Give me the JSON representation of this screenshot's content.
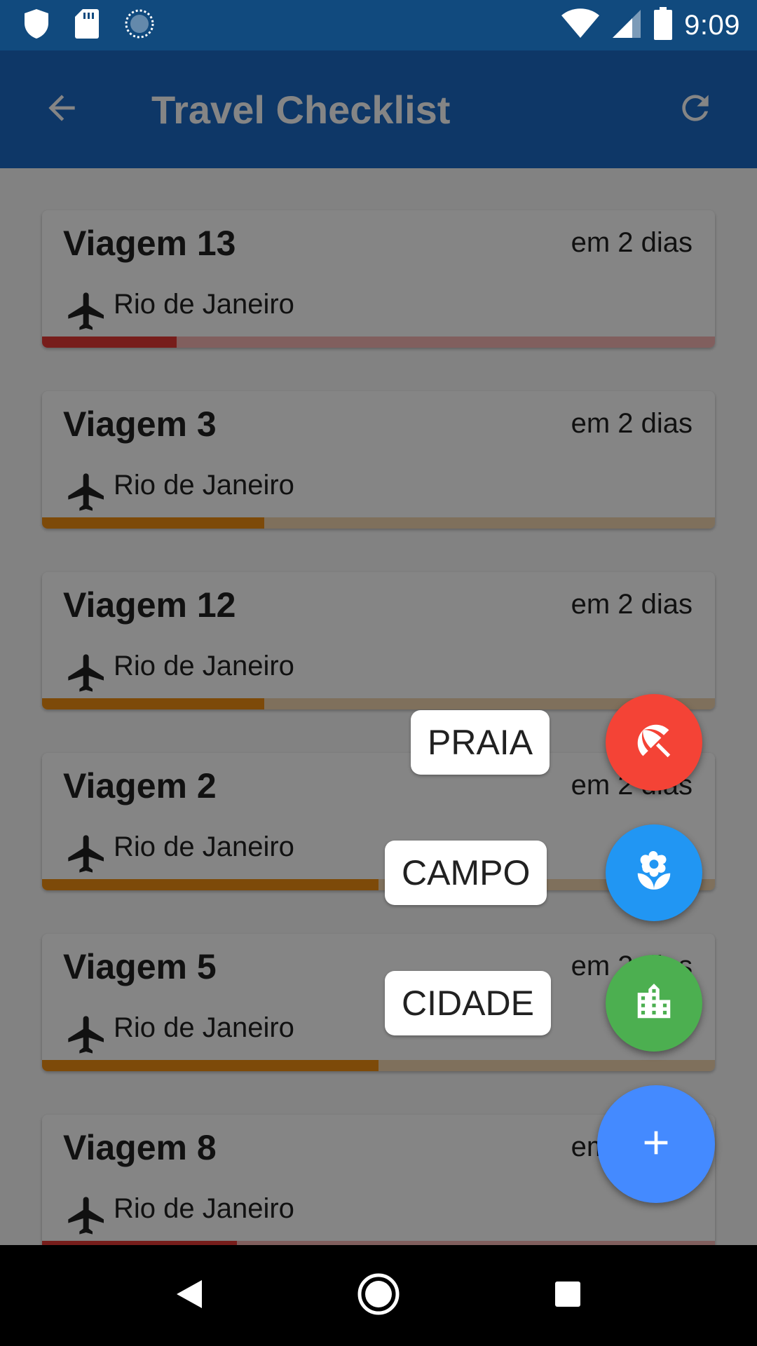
{
  "status_bar": {
    "time": "9:09",
    "left_icons": [
      "shield-icon",
      "sd-card-icon",
      "sync-icon"
    ],
    "right_icons": [
      "wifi-icon",
      "cell-signal-icon",
      "battery-icon"
    ]
  },
  "app_bar": {
    "title": "Travel Checklist",
    "back_icon": "arrow-back-icon",
    "refresh_icon": "refresh-icon"
  },
  "trips": [
    {
      "name": "Viagem 13",
      "when": "em 2 dias",
      "destination": "Rio de Janeiro",
      "progress": 0.2,
      "color": "#e53935",
      "track": "#f7b6b5"
    },
    {
      "name": "Viagem 3",
      "when": "em 2 dias",
      "destination": "Rio de Janeiro",
      "progress": 0.33,
      "color": "#ef8f12",
      "track": "#f3d6b0"
    },
    {
      "name": "Viagem 12",
      "when": "em 2 dias",
      "destination": "Rio de Janeiro",
      "progress": 0.33,
      "color": "#ef8f12",
      "track": "#f3d6b0"
    },
    {
      "name": "Viagem 2",
      "when": "em 2 dias",
      "destination": "Rio de Janeiro",
      "progress": 0.5,
      "color": "#ef8f12",
      "track": "#f3d6b0"
    },
    {
      "name": "Viagem 5",
      "when": "em 2 dias",
      "destination": "Rio de Janeiro",
      "progress": 0.5,
      "color": "#ef8f12",
      "track": "#f3d6b0"
    },
    {
      "name": "Viagem 8",
      "when": "em 2 dias",
      "destination": "Rio de Janeiro",
      "progress": 0.29,
      "color": "#e53935",
      "track": "#f7b6b5"
    }
  ],
  "speed_dial": {
    "options": [
      {
        "label": "PRAIA",
        "icon": "beach-umbrella-icon",
        "color": "#f44336"
      },
      {
        "label": "CAMPO",
        "icon": "flower-icon",
        "color": "#2196f3"
      },
      {
        "label": "CIDADE",
        "icon": "city-buildings-icon",
        "color": "#4caf50"
      }
    ],
    "main": {
      "icon": "add-icon",
      "color": "#448aff"
    }
  },
  "nav_bar": {
    "icons": [
      "nav-back-icon",
      "nav-home-icon",
      "nav-recents-icon"
    ]
  }
}
